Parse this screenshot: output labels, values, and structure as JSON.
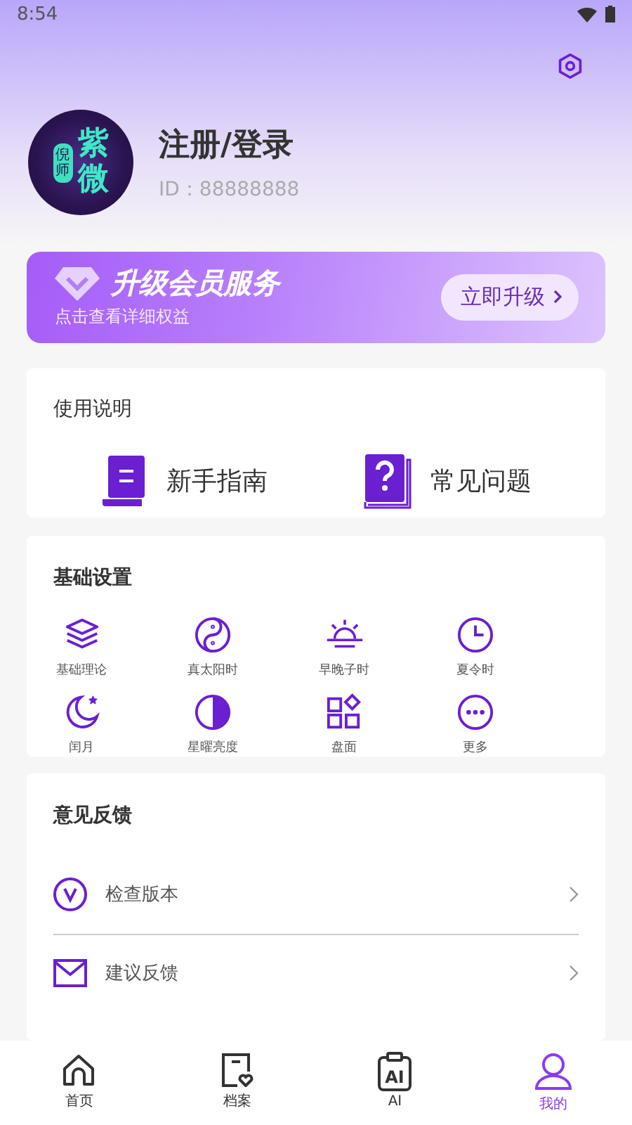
{
  "status_bar": {
    "time": "8:54"
  },
  "profile": {
    "avatar": {
      "badge": "倪师",
      "title": "紫微"
    },
    "name": "注册/登录",
    "id": "ID：88888888"
  },
  "vip_banner": {
    "title": "升级会员服务",
    "subtitle": "点击查看详细权益",
    "button": "立即升级"
  },
  "guide": {
    "title": "使用说明",
    "items": [
      {
        "label": "新手指南"
      },
      {
        "label": "常见问题"
      }
    ]
  },
  "settings": {
    "title": "基础设置",
    "items": [
      {
        "label": "基础理论"
      },
      {
        "label": "真太阳时"
      },
      {
        "label": "早晚子时"
      },
      {
        "label": "夏令时"
      },
      {
        "label": "闰月"
      },
      {
        "label": "星曜亮度"
      },
      {
        "label": "盘面"
      },
      {
        "label": "更多"
      }
    ]
  },
  "feedback": {
    "title": "意见反馈",
    "items": [
      {
        "label": "检查版本"
      },
      {
        "label": "建议反馈"
      }
    ]
  },
  "tab_bar": [
    {
      "label": "首页",
      "selected": false
    },
    {
      "label": "档案",
      "selected": false
    },
    {
      "label": "AI",
      "icon_text": "AI",
      "selected": false
    },
    {
      "label": "我的",
      "selected": true
    }
  ]
}
